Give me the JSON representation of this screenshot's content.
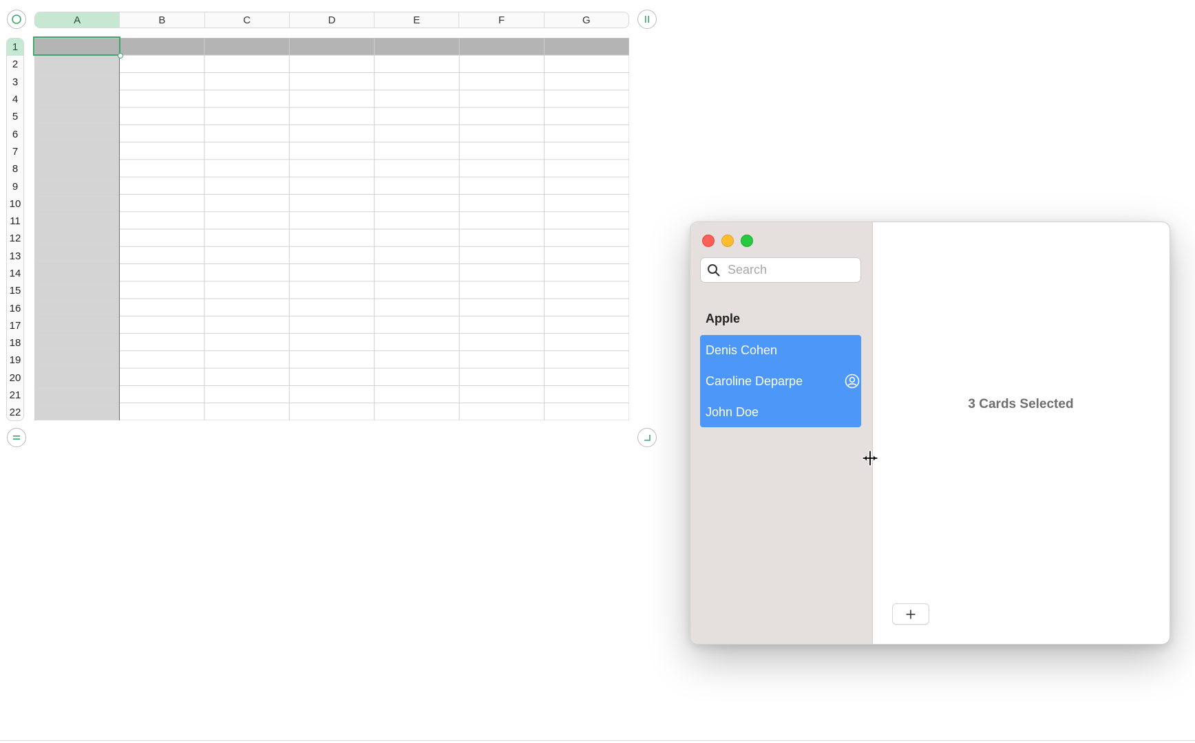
{
  "spreadsheet": {
    "columns": [
      "A",
      "B",
      "C",
      "D",
      "E",
      "F",
      "G"
    ],
    "rows": [
      "1",
      "2",
      "3",
      "4",
      "5",
      "6",
      "7",
      "8",
      "9",
      "10",
      "11",
      "12",
      "13",
      "14",
      "15",
      "16",
      "17",
      "18",
      "19",
      "20",
      "21",
      "22"
    ],
    "selected_column": "A",
    "selected_row": "1",
    "selected_cell": "A1",
    "top_left_control_icon": "circle-icon",
    "top_right_control_icon": "pause-bars-icon",
    "bottom_left_control_icon": "equals-icon",
    "bottom_right_control_icon": "resize-corner-icon",
    "colors": {
      "accent": "#3ba76b",
      "header_selected": "#c6e7d2",
      "row1_fill": "#b4b4b4",
      "colA_fill": "#d4d4d4"
    }
  },
  "contacts_window": {
    "search": {
      "placeholder": "Search",
      "value": ""
    },
    "group_title": "Apple",
    "contacts": [
      {
        "name": "Denis Cohen",
        "me_card": false
      },
      {
        "name": "Caroline Deparpe",
        "me_card": true
      },
      {
        "name": "John Doe",
        "me_card": false
      }
    ],
    "selection_label": "3 Cards Selected",
    "add_button_label": "+",
    "colors": {
      "selection": "#4c97f7",
      "sidebar": "#e5e0de",
      "close": "#fe5f57",
      "minimize": "#febc2e",
      "zoom": "#28c840"
    }
  }
}
